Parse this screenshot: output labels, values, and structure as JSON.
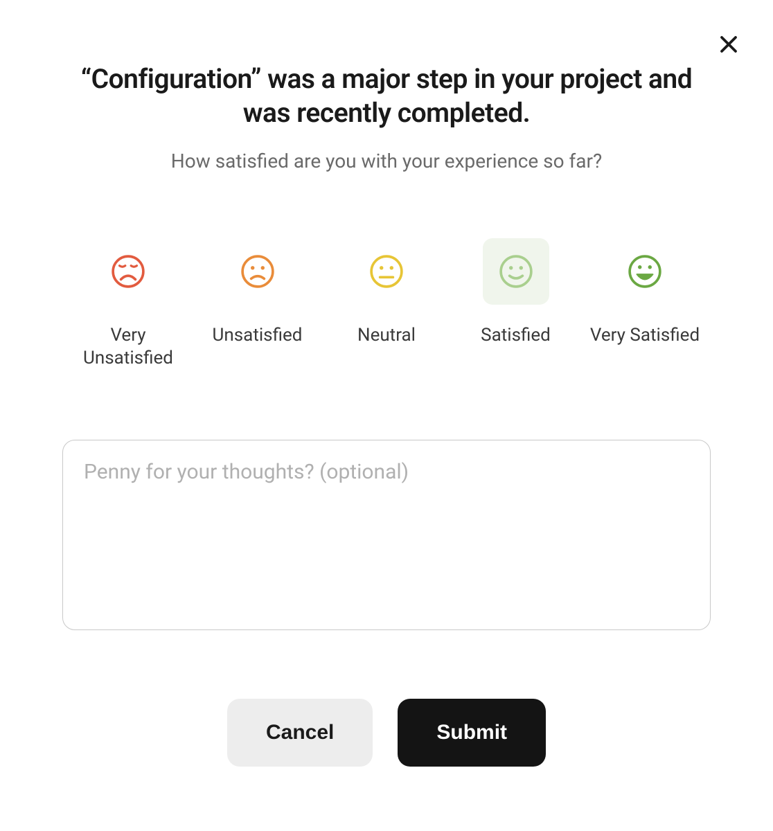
{
  "modal": {
    "title": "“Configuration” was a major step in your project and was recently completed.",
    "subtitle": "How satisfied are you with your experience so far?",
    "ratings": [
      {
        "label": "Very Unsatisfied",
        "icon": "face-very-unsatisfied",
        "color": "#e25b3f",
        "selected": false
      },
      {
        "label": "Unsatisfied",
        "icon": "face-unsatisfied",
        "color": "#e98c3a",
        "selected": false
      },
      {
        "label": "Neutral",
        "icon": "face-neutral",
        "color": "#e7c536",
        "selected": false
      },
      {
        "label": "Satisfied",
        "icon": "face-satisfied",
        "color": "#a9cf8e",
        "selected": true
      },
      {
        "label": "Very Satisfied",
        "icon": "face-very-satisfied",
        "color": "#6ba843",
        "selected": false
      }
    ],
    "feedback": {
      "placeholder": "Penny for your thoughts? (optional)",
      "value": ""
    },
    "buttons": {
      "cancel": "Cancel",
      "submit": "Submit"
    }
  }
}
